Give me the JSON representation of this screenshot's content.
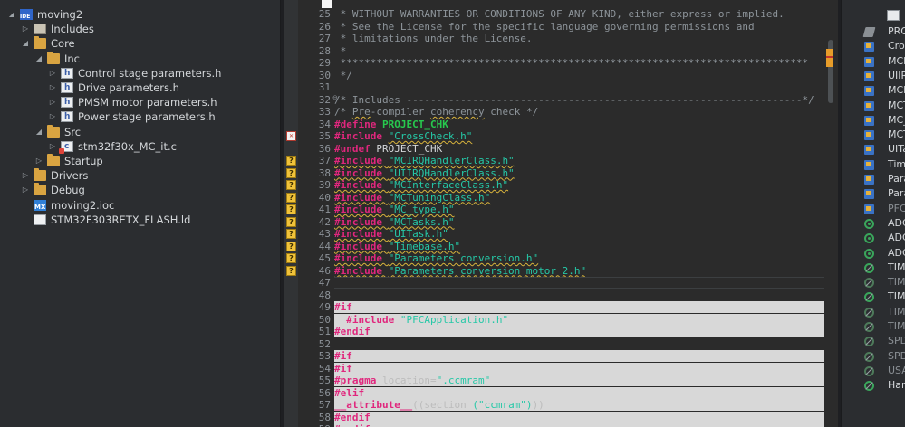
{
  "explorer": {
    "items": [
      {
        "label": "moving2",
        "icon": "ide-project-icon",
        "indent": 0,
        "twisty": "expanded"
      },
      {
        "label": "Includes",
        "icon": "includes-icon",
        "indent": 1,
        "twisty": "collapsed"
      },
      {
        "label": "Core",
        "icon": "folder-icon",
        "indent": 1,
        "twisty": "expanded"
      },
      {
        "label": "Inc",
        "icon": "folder-icon",
        "indent": 2,
        "twisty": "expanded"
      },
      {
        "label": "Control stage parameters.h",
        "icon": "header-file-icon",
        "indent": 3,
        "twisty": "collapsed"
      },
      {
        "label": "Drive parameters.h",
        "icon": "header-file-icon",
        "indent": 3,
        "twisty": "collapsed"
      },
      {
        "label": "PMSM motor parameters.h",
        "icon": "header-file-icon",
        "indent": 3,
        "twisty": "collapsed"
      },
      {
        "label": "Power stage parameters.h",
        "icon": "header-file-icon",
        "indent": 3,
        "twisty": "collapsed"
      },
      {
        "label": "Src",
        "icon": "folder-icon",
        "indent": 2,
        "twisty": "expanded"
      },
      {
        "label": "stm32f30x_MC_it.c",
        "icon": "c-file-icon",
        "indent": 3,
        "twisty": "collapsed",
        "error": true
      },
      {
        "label": "Startup",
        "icon": "folder-icon",
        "indent": 2,
        "twisty": "collapsed"
      },
      {
        "label": "Drivers",
        "icon": "folder-icon",
        "indent": 1,
        "twisty": "collapsed"
      },
      {
        "label": "Debug",
        "icon": "folder-icon",
        "indent": 1,
        "twisty": "collapsed"
      },
      {
        "label": "moving2.ioc",
        "icon": "mx-file-icon",
        "indent": 1,
        "twisty": "none"
      },
      {
        "label": "STM32F303RETX_FLASH.ld",
        "icon": "ld-file-icon",
        "indent": 1,
        "twisty": "none"
      }
    ]
  },
  "editor": {
    "lines": [
      {
        "n": "25",
        "segs": [
          {
            "t": " * WITHOUT WARRANTIES OR CONDITIONS OF ANY KIND, either express or implied.",
            "c": "cm"
          }
        ]
      },
      {
        "n": "26",
        "segs": [
          {
            "t": " * See the License for the specific language governing permissions and",
            "c": "cm"
          }
        ]
      },
      {
        "n": "27",
        "segs": [
          {
            "t": " * limitations under the License.",
            "c": "cm"
          }
        ]
      },
      {
        "n": "28",
        "segs": [
          {
            "t": " *",
            "c": "cm"
          }
        ]
      },
      {
        "n": "29",
        "segs": [
          {
            "t": " ******************************************************************************",
            "c": "cm"
          }
        ]
      },
      {
        "n": "30",
        "segs": [
          {
            "t": " */",
            "c": "cm"
          }
        ]
      },
      {
        "n": "31",
        "segs": []
      },
      {
        "n": "32",
        "segs": [
          {
            "t": "/* Includes ------------------------------------------------------------------*/",
            "c": "cm"
          }
        ]
      },
      {
        "n": "33",
        "segs": [
          {
            "t": "/* ",
            "c": "cm"
          },
          {
            "t": "Pre",
            "c": "cm sq"
          },
          {
            "t": "-compiler ",
            "c": "cm"
          },
          {
            "t": "coherency",
            "c": "cm sq"
          },
          {
            "t": " check */",
            "c": "cm"
          }
        ]
      },
      {
        "n": "34",
        "segs": [
          {
            "t": "#define ",
            "c": "pp"
          },
          {
            "t": "PROJECT_CHK",
            "c": "mac"
          }
        ]
      },
      {
        "n": "35",
        "mark": "err",
        "segs": [
          {
            "t": "#include ",
            "c": "pp"
          },
          {
            "t": "\"CrossCheck.h\"",
            "c": "str sq"
          }
        ]
      },
      {
        "n": "36",
        "segs": [
          {
            "t": "#undef ",
            "c": "pp"
          },
          {
            "t": "PROJECT_CHK",
            "c": "plain"
          }
        ]
      },
      {
        "n": "37",
        "mark": "q",
        "segs": [
          {
            "t": "#include ",
            "c": "pp sq"
          },
          {
            "t": "\"MCIRQHandlerClass.h\"",
            "c": "str sq"
          }
        ]
      },
      {
        "n": "38",
        "mark": "q",
        "segs": [
          {
            "t": "#include ",
            "c": "pp sq"
          },
          {
            "t": "\"UIIRQHandlerClass.h\"",
            "c": "str sq"
          }
        ]
      },
      {
        "n": "39",
        "mark": "q",
        "segs": [
          {
            "t": "#include ",
            "c": "pp sq"
          },
          {
            "t": "\"MCInterfaceClass.h\"",
            "c": "str sq"
          }
        ]
      },
      {
        "n": "40",
        "mark": "q",
        "segs": [
          {
            "t": "#include ",
            "c": "pp sq"
          },
          {
            "t": "\"MCTuningClass.h\"",
            "c": "str sq"
          }
        ]
      },
      {
        "n": "41",
        "mark": "q",
        "segs": [
          {
            "t": "#include ",
            "c": "pp sq"
          },
          {
            "t": "\"MC_type.h\"",
            "c": "str sq"
          }
        ]
      },
      {
        "n": "42",
        "mark": "q",
        "segs": [
          {
            "t": "#include ",
            "c": "pp sq"
          },
          {
            "t": "\"MCTasks.h\"",
            "c": "str sq"
          }
        ]
      },
      {
        "n": "43",
        "mark": "q",
        "segs": [
          {
            "t": "#include ",
            "c": "pp sq"
          },
          {
            "t": "\"UITask.h\"",
            "c": "str sq"
          }
        ]
      },
      {
        "n": "44",
        "mark": "q",
        "segs": [
          {
            "t": "#include ",
            "c": "pp sq"
          },
          {
            "t": "\"Timebase.h\"",
            "c": "str sq"
          }
        ]
      },
      {
        "n": "45",
        "mark": "q",
        "segs": [
          {
            "t": "#include ",
            "c": "pp sq"
          },
          {
            "t": "\"Parameters conversion.h\"",
            "c": "str sq"
          }
        ]
      },
      {
        "n": "46",
        "mark": "q",
        "segs": [
          {
            "t": "#include ",
            "c": "pp sq"
          },
          {
            "t": "\"Parameters conversion motor 2.h\"",
            "c": "str sq"
          }
        ]
      },
      {
        "n": "47",
        "current": true,
        "segs": []
      },
      {
        "n": "48",
        "segs": []
      },
      {
        "n": "49",
        "inactive": true,
        "segs": [
          {
            "t": "#if",
            "c": "pp"
          }
        ]
      },
      {
        "n": "50",
        "inactive": true,
        "segs": [
          {
            "t": "  #include ",
            "c": "pp"
          },
          {
            "t": "\"PFCApplication.h\"",
            "c": "str"
          }
        ]
      },
      {
        "n": "51",
        "inactive": true,
        "segs": [
          {
            "t": "#endif",
            "c": "pp"
          }
        ]
      },
      {
        "n": "52",
        "segs": []
      },
      {
        "n": "53",
        "inactive": true,
        "segs": [
          {
            "t": "#if",
            "c": "pp"
          }
        ]
      },
      {
        "n": "54",
        "inactive": true,
        "segs": [
          {
            "t": "#if",
            "c": "pp"
          }
        ]
      },
      {
        "n": "55",
        "inactive": true,
        "segs": [
          {
            "t": "#pragma ",
            "c": "pp"
          },
          {
            "t": "location=",
            "c": "dim"
          },
          {
            "t": "\".ccmram\"",
            "c": "str"
          }
        ]
      },
      {
        "n": "56",
        "inactive": true,
        "segs": [
          {
            "t": "#elif",
            "c": "pp"
          }
        ]
      },
      {
        "n": "57",
        "inactive": true,
        "segs": [
          {
            "t": "__attribute__",
            "c": "pp"
          },
          {
            "t": "((section ",
            "c": "dim"
          },
          {
            "t": "(\"ccmram\")",
            "c": "str"
          },
          {
            "t": "))",
            "c": "dim"
          }
        ]
      },
      {
        "n": "58",
        "inactive": true,
        "segs": [
          {
            "t": "#endif",
            "c": "pp"
          }
        ]
      },
      {
        "n": "59",
        "inactive": true,
        "segs": [
          {
            "t": "#endif",
            "c": "pp"
          }
        ]
      }
    ]
  },
  "outline": {
    "items": [
      {
        "label": "PROJ",
        "icon": "define-icon",
        "dim": false
      },
      {
        "label": "Cross",
        "icon": "include-icon",
        "dim": false
      },
      {
        "label": "MCIR",
        "icon": "include-icon",
        "dim": false
      },
      {
        "label": "UIIRQ",
        "icon": "include-icon",
        "dim": false
      },
      {
        "label": "MCIn",
        "icon": "include-icon",
        "dim": false
      },
      {
        "label": "MCTu",
        "icon": "include-icon",
        "dim": false
      },
      {
        "label": "MC_t",
        "icon": "include-icon",
        "dim": false
      },
      {
        "label": "MCTa",
        "icon": "include-icon",
        "dim": false
      },
      {
        "label": "UITas",
        "icon": "include-icon",
        "dim": false
      },
      {
        "label": "Time",
        "icon": "include-icon",
        "dim": false
      },
      {
        "label": "Para",
        "icon": "include-icon",
        "dim": false
      },
      {
        "label": "Para",
        "icon": "include-icon",
        "dim": false
      },
      {
        "label": "PFCA",
        "icon": "include-icon",
        "dim": true
      },
      {
        "label": "ADC",
        "icon": "variable-icon",
        "dim": false
      },
      {
        "label": "ADC",
        "icon": "variable-icon",
        "dim": false
      },
      {
        "label": "ADC",
        "icon": "variable-icon",
        "dim": false
      },
      {
        "label": "TIMx",
        "icon": "function-icon",
        "dim": false
      },
      {
        "label": "TIMT",
        "icon": "function-icon",
        "dim": true
      },
      {
        "label": "TIMx",
        "icon": "function-icon",
        "dim": false
      },
      {
        "label": "TIMx",
        "icon": "function-icon",
        "dim": true
      },
      {
        "label": "TIMx",
        "icon": "function-icon",
        "dim": true
      },
      {
        "label": "SPD_",
        "icon": "function-icon",
        "dim": true
      },
      {
        "label": "SPD_",
        "icon": "function-icon",
        "dim": true
      },
      {
        "label": "USAR",
        "icon": "function-icon",
        "dim": true
      },
      {
        "label": "Hard",
        "icon": "function-icon",
        "dim": false
      }
    ]
  }
}
